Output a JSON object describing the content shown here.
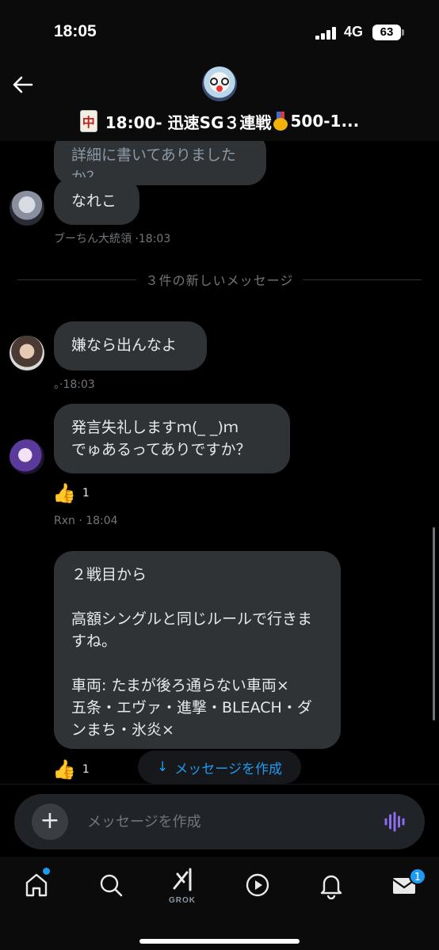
{
  "status_bar": {
    "time": "18:05",
    "network": "4G",
    "battery": "63"
  },
  "header": {
    "title": "18:00- 迅速SG３連戦",
    "title_tail": "500-1...",
    "tile_glyph": "中",
    "back_icon": "arrow-left-icon",
    "accent_color": "#1d9bf0"
  },
  "messages": {
    "m1_text": "詳細に書いてありましたか？",
    "m2_text": "なれこ",
    "m2_meta": "ブーちん大統領 ·18:03",
    "divider": "３件の新しいメッセージ",
    "m3_text": "嫌なら出んなよ",
    "m3_meta": "。·18:03",
    "m4_text": "発言失礼しますｍ(_ _)ｍ\nでゅあるってありですか？",
    "m4_reaction_count": "1",
    "m4_meta": "Rxn · 18:04",
    "m5_text": "２戦目から\n\n高額シングルと同じルールで行きますね。\n\n車両: たまが後ろ通らない車両×\n五条・エヴァ・進撃・BLEACH・ダンまち・氷炎×",
    "m5_reaction_count": "1"
  },
  "compose_pill": {
    "arrow": "↓",
    "label": "メッセージを作成"
  },
  "composer": {
    "placeholder": "メッセージを作成",
    "plus": "+"
  },
  "tabbar": {
    "items": [
      "home-icon",
      "search-icon",
      "grok-icon",
      "video-icon",
      "bell-icon",
      "mail-icon"
    ],
    "grok_label": "GROK",
    "mail_badge": "1"
  }
}
